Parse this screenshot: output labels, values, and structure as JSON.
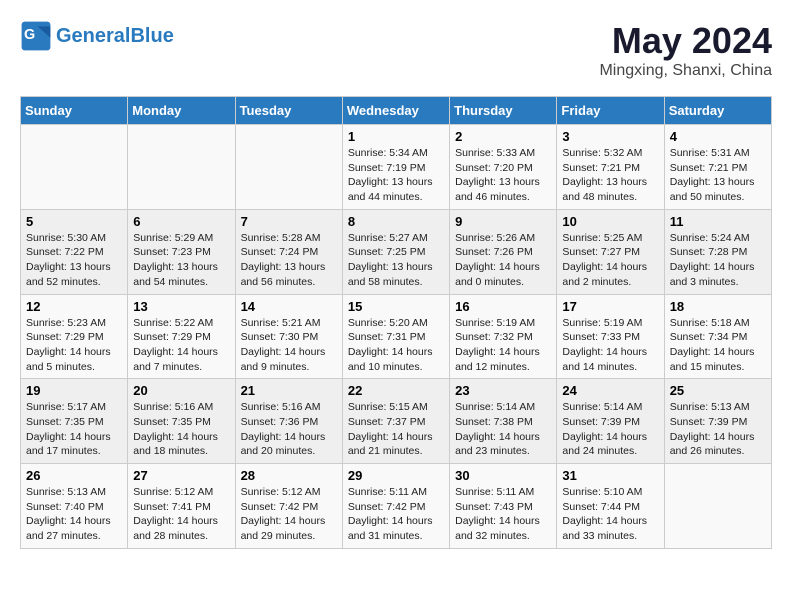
{
  "header": {
    "logo_text_general": "General",
    "logo_text_blue": "Blue",
    "month": "May 2024",
    "location": "Mingxing, Shanxi, China"
  },
  "weekdays": [
    "Sunday",
    "Monday",
    "Tuesday",
    "Wednesday",
    "Thursday",
    "Friday",
    "Saturday"
  ],
  "weeks": [
    [
      {
        "day": "",
        "sunrise": "",
        "sunset": "",
        "daylight": ""
      },
      {
        "day": "",
        "sunrise": "",
        "sunset": "",
        "daylight": ""
      },
      {
        "day": "",
        "sunrise": "",
        "sunset": "",
        "daylight": ""
      },
      {
        "day": "1",
        "sunrise": "Sunrise: 5:34 AM",
        "sunset": "Sunset: 7:19 PM",
        "daylight": "Daylight: 13 hours and 44 minutes."
      },
      {
        "day": "2",
        "sunrise": "Sunrise: 5:33 AM",
        "sunset": "Sunset: 7:20 PM",
        "daylight": "Daylight: 13 hours and 46 minutes."
      },
      {
        "day": "3",
        "sunrise": "Sunrise: 5:32 AM",
        "sunset": "Sunset: 7:21 PM",
        "daylight": "Daylight: 13 hours and 48 minutes."
      },
      {
        "day": "4",
        "sunrise": "Sunrise: 5:31 AM",
        "sunset": "Sunset: 7:21 PM",
        "daylight": "Daylight: 13 hours and 50 minutes."
      }
    ],
    [
      {
        "day": "5",
        "sunrise": "Sunrise: 5:30 AM",
        "sunset": "Sunset: 7:22 PM",
        "daylight": "Daylight: 13 hours and 52 minutes."
      },
      {
        "day": "6",
        "sunrise": "Sunrise: 5:29 AM",
        "sunset": "Sunset: 7:23 PM",
        "daylight": "Daylight: 13 hours and 54 minutes."
      },
      {
        "day": "7",
        "sunrise": "Sunrise: 5:28 AM",
        "sunset": "Sunset: 7:24 PM",
        "daylight": "Daylight: 13 hours and 56 minutes."
      },
      {
        "day": "8",
        "sunrise": "Sunrise: 5:27 AM",
        "sunset": "Sunset: 7:25 PM",
        "daylight": "Daylight: 13 hours and 58 minutes."
      },
      {
        "day": "9",
        "sunrise": "Sunrise: 5:26 AM",
        "sunset": "Sunset: 7:26 PM",
        "daylight": "Daylight: 14 hours and 0 minutes."
      },
      {
        "day": "10",
        "sunrise": "Sunrise: 5:25 AM",
        "sunset": "Sunset: 7:27 PM",
        "daylight": "Daylight: 14 hours and 2 minutes."
      },
      {
        "day": "11",
        "sunrise": "Sunrise: 5:24 AM",
        "sunset": "Sunset: 7:28 PM",
        "daylight": "Daylight: 14 hours and 3 minutes."
      }
    ],
    [
      {
        "day": "12",
        "sunrise": "Sunrise: 5:23 AM",
        "sunset": "Sunset: 7:29 PM",
        "daylight": "Daylight: 14 hours and 5 minutes."
      },
      {
        "day": "13",
        "sunrise": "Sunrise: 5:22 AM",
        "sunset": "Sunset: 7:29 PM",
        "daylight": "Daylight: 14 hours and 7 minutes."
      },
      {
        "day": "14",
        "sunrise": "Sunrise: 5:21 AM",
        "sunset": "Sunset: 7:30 PM",
        "daylight": "Daylight: 14 hours and 9 minutes."
      },
      {
        "day": "15",
        "sunrise": "Sunrise: 5:20 AM",
        "sunset": "Sunset: 7:31 PM",
        "daylight": "Daylight: 14 hours and 10 minutes."
      },
      {
        "day": "16",
        "sunrise": "Sunrise: 5:19 AM",
        "sunset": "Sunset: 7:32 PM",
        "daylight": "Daylight: 14 hours and 12 minutes."
      },
      {
        "day": "17",
        "sunrise": "Sunrise: 5:19 AM",
        "sunset": "Sunset: 7:33 PM",
        "daylight": "Daylight: 14 hours and 14 minutes."
      },
      {
        "day": "18",
        "sunrise": "Sunrise: 5:18 AM",
        "sunset": "Sunset: 7:34 PM",
        "daylight": "Daylight: 14 hours and 15 minutes."
      }
    ],
    [
      {
        "day": "19",
        "sunrise": "Sunrise: 5:17 AM",
        "sunset": "Sunset: 7:35 PM",
        "daylight": "Daylight: 14 hours and 17 minutes."
      },
      {
        "day": "20",
        "sunrise": "Sunrise: 5:16 AM",
        "sunset": "Sunset: 7:35 PM",
        "daylight": "Daylight: 14 hours and 18 minutes."
      },
      {
        "day": "21",
        "sunrise": "Sunrise: 5:16 AM",
        "sunset": "Sunset: 7:36 PM",
        "daylight": "Daylight: 14 hours and 20 minutes."
      },
      {
        "day": "22",
        "sunrise": "Sunrise: 5:15 AM",
        "sunset": "Sunset: 7:37 PM",
        "daylight": "Daylight: 14 hours and 21 minutes."
      },
      {
        "day": "23",
        "sunrise": "Sunrise: 5:14 AM",
        "sunset": "Sunset: 7:38 PM",
        "daylight": "Daylight: 14 hours and 23 minutes."
      },
      {
        "day": "24",
        "sunrise": "Sunrise: 5:14 AM",
        "sunset": "Sunset: 7:39 PM",
        "daylight": "Daylight: 14 hours and 24 minutes."
      },
      {
        "day": "25",
        "sunrise": "Sunrise: 5:13 AM",
        "sunset": "Sunset: 7:39 PM",
        "daylight": "Daylight: 14 hours and 26 minutes."
      }
    ],
    [
      {
        "day": "26",
        "sunrise": "Sunrise: 5:13 AM",
        "sunset": "Sunset: 7:40 PM",
        "daylight": "Daylight: 14 hours and 27 minutes."
      },
      {
        "day": "27",
        "sunrise": "Sunrise: 5:12 AM",
        "sunset": "Sunset: 7:41 PM",
        "daylight": "Daylight: 14 hours and 28 minutes."
      },
      {
        "day": "28",
        "sunrise": "Sunrise: 5:12 AM",
        "sunset": "Sunset: 7:42 PM",
        "daylight": "Daylight: 14 hours and 29 minutes."
      },
      {
        "day": "29",
        "sunrise": "Sunrise: 5:11 AM",
        "sunset": "Sunset: 7:42 PM",
        "daylight": "Daylight: 14 hours and 31 minutes."
      },
      {
        "day": "30",
        "sunrise": "Sunrise: 5:11 AM",
        "sunset": "Sunset: 7:43 PM",
        "daylight": "Daylight: 14 hours and 32 minutes."
      },
      {
        "day": "31",
        "sunrise": "Sunrise: 5:10 AM",
        "sunset": "Sunset: 7:44 PM",
        "daylight": "Daylight: 14 hours and 33 minutes."
      },
      {
        "day": "",
        "sunrise": "",
        "sunset": "",
        "daylight": ""
      }
    ]
  ]
}
